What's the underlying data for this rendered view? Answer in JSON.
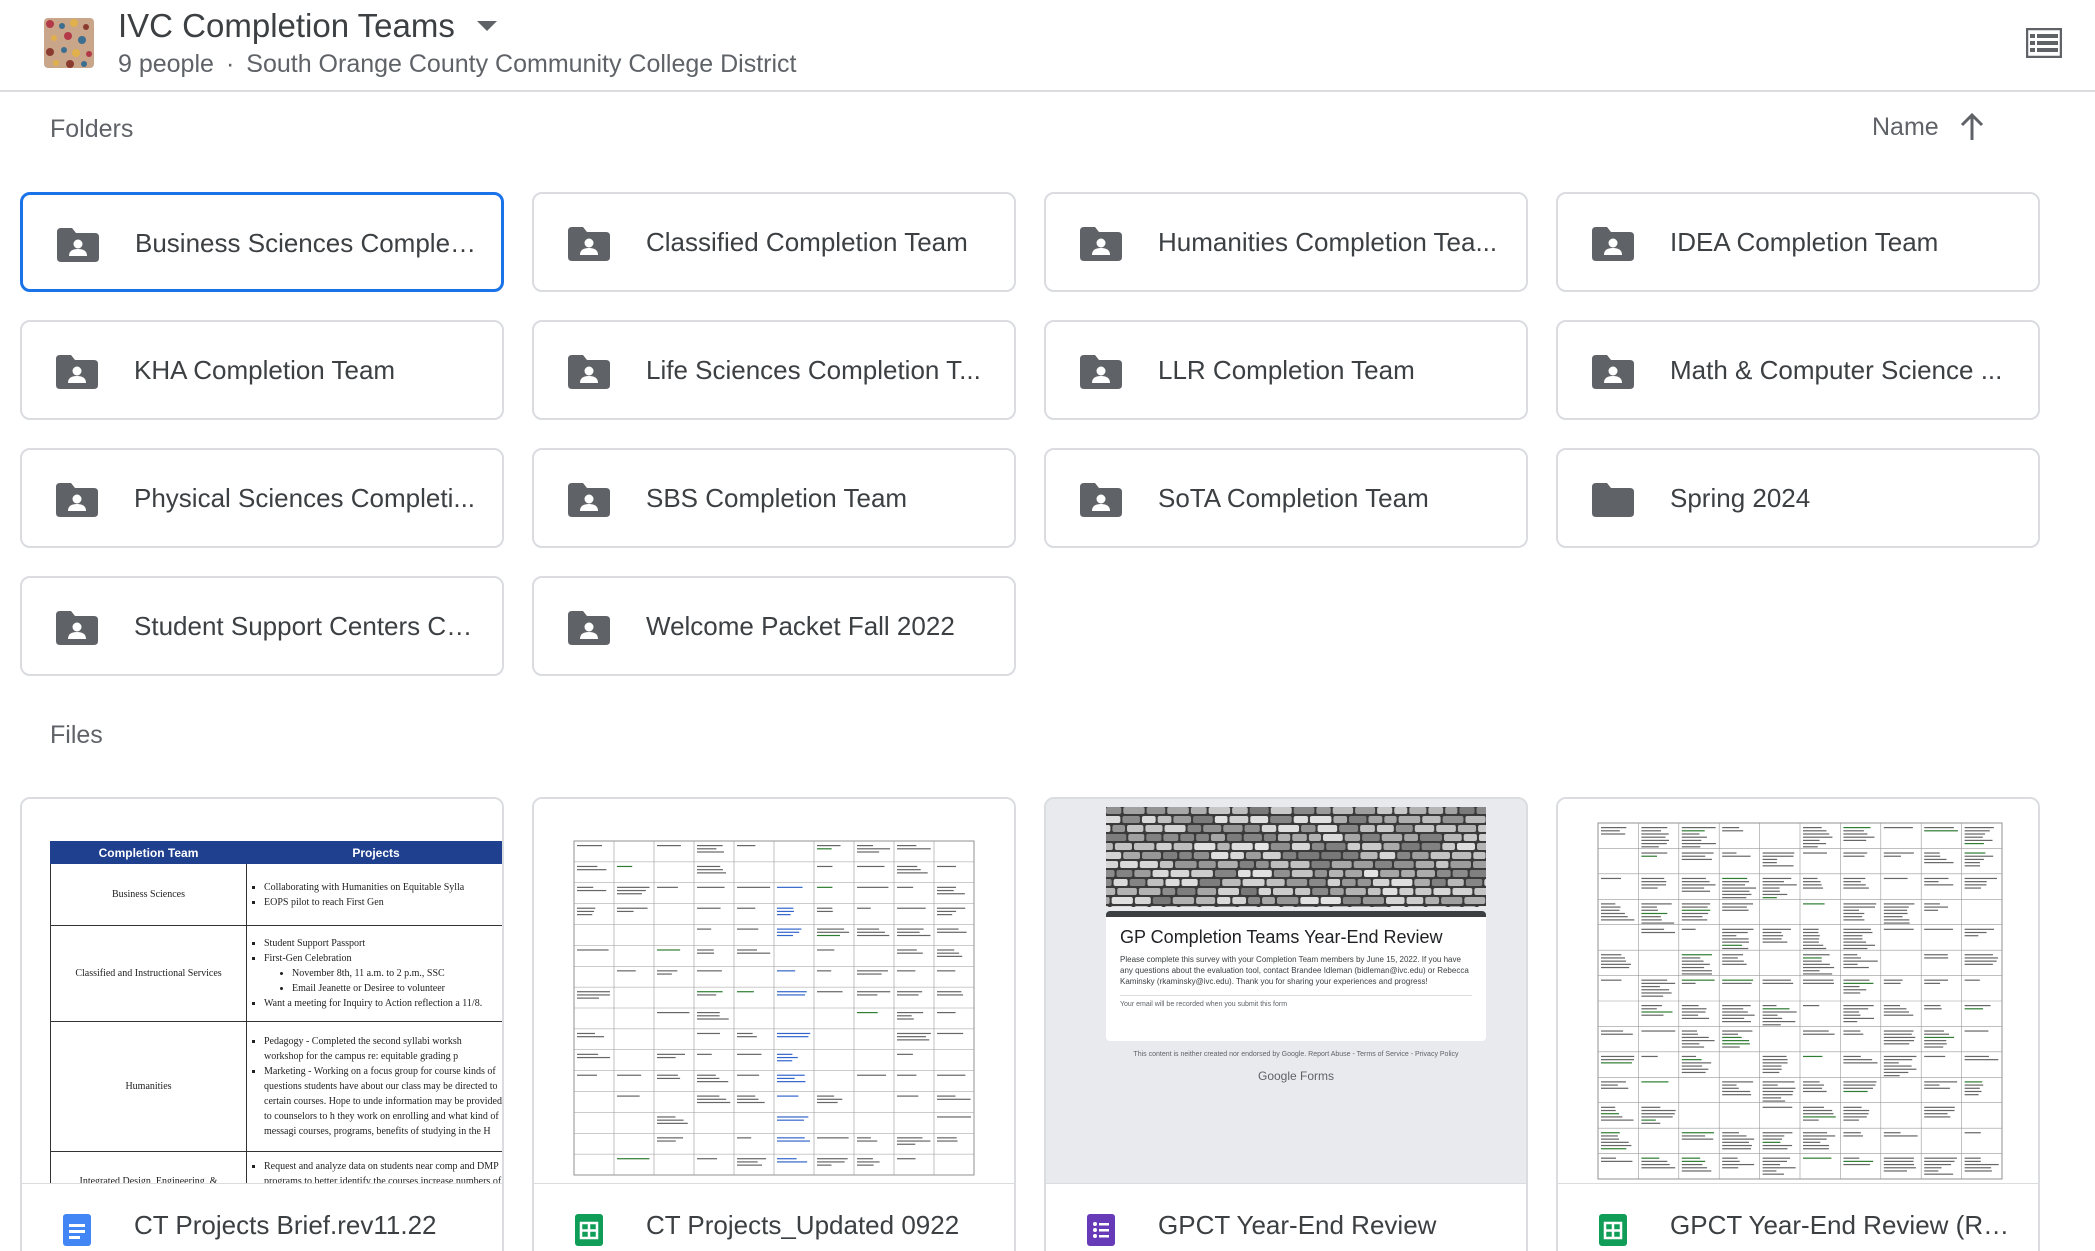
{
  "header": {
    "title": "IVC Completion Teams",
    "people": "9 people",
    "separator": "·",
    "org": "South Orange County Community College District"
  },
  "folders_section": {
    "label": "Folders",
    "sort_label": "Name"
  },
  "folders": [
    {
      "label": "Business Sciences Complet...",
      "shared": true,
      "selected": true
    },
    {
      "label": "Classified Completion Team",
      "shared": true
    },
    {
      "label": "Humanities Completion Tea...",
      "shared": true
    },
    {
      "label": "IDEA Completion Team",
      "shared": true
    },
    {
      "label": "KHA Completion Team",
      "shared": true
    },
    {
      "label": "Life Sciences Completion T...",
      "shared": true
    },
    {
      "label": "LLR Completion Team",
      "shared": true
    },
    {
      "label": "Math & Computer Science ...",
      "shared": true
    },
    {
      "label": "Physical Sciences Completi...",
      "shared": true
    },
    {
      "label": "SBS Completion Team",
      "shared": true
    },
    {
      "label": "SoTA Completion Team",
      "shared": true
    },
    {
      "label": "Spring 2024",
      "shared": false
    },
    {
      "label": "Student Support Centers Co...",
      "shared": true
    },
    {
      "label": "Welcome Packet Fall 2022",
      "shared": true
    }
  ],
  "files_section": {
    "label": "Files"
  },
  "files": [
    {
      "label": "CT Projects Brief.rev11.22",
      "type": "docs",
      "icon": "google-docs-icon"
    },
    {
      "label": "CT Projects_Updated 0922",
      "type": "sheets",
      "icon": "google-sheets-icon"
    },
    {
      "label": "GPCT Year-End Review",
      "type": "forms",
      "icon": "google-forms-icon"
    },
    {
      "label": "GPCT Year-End Review (Res...",
      "type": "sheets",
      "icon": "google-sheets-icon"
    }
  ],
  "brief_thumb": {
    "col_team": "Completion Team",
    "col_projects": "Projects",
    "rows": [
      {
        "team": "Business Sciences",
        "items": [
          "Collaborating with Humanities on Equitable Sylla",
          "EOPS pilot to reach First Gen"
        ]
      },
      {
        "team": "Classified and Instructional Services",
        "items": [
          "Student Support Passport",
          "First-Gen Celebration"
        ],
        "sub": [
          "November 8th, 11 a.m. to 2 p.m., SSC",
          "Email Jeanette or Desiree to volunteer"
        ],
        "tail": [
          "Want a meeting for Inquiry to Action reflection a 11/8."
        ]
      },
      {
        "team": "Humanities",
        "items": [
          "Pedagogy - Completed the second syllabi worksh workshop for the campus re: equitable grading p",
          "Marketing - Working on a focus group for course kinds of questions students have about our class may be directed to certain courses. Hope to unde information may be provided to counselors to h they work on enrolling and what kind of messagi courses, programs, benefits of studying in the H"
        ]
      },
      {
        "team": "Integrated Design, Engineering, &",
        "items": [
          "Request and analyze data on students near comp and DMP programs to better identify the courses increase numbers of completers."
        ]
      }
    ]
  },
  "form_thumb": {
    "title": "GP Completion Teams Year-End Review",
    "description": "Please complete this survey with your Completion Team members by June 15, 2022. If you have any questions about the evaluation tool, contact Brandee Idleman (bidleman@ivc.edu) or Rebecca Kaminsky (rkaminsky@ivc.edu). Thank you for sharing your experiences and progress!",
    "note": "Your email will be recorded when you submit this form",
    "disclaimer": "This content is neither created nor endorsed by Google. Report Abuse - Terms of Service - Privacy Policy",
    "brand": "Google Forms"
  },
  "colors": {
    "selected_border": "#1a73e8",
    "docs": "#4285f4",
    "sheets": "#0f9d58",
    "forms": "#673ab7",
    "folder": "#5f6368"
  }
}
